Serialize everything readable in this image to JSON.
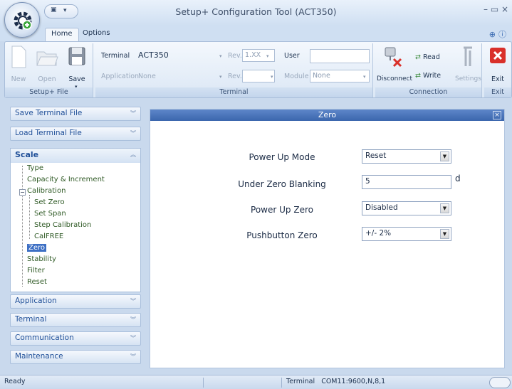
{
  "window": {
    "title": "Setup+ Configuration Tool (ACT350)",
    "controls": "– ▭ ×"
  },
  "tabs": [
    {
      "label": "Home"
    },
    {
      "label": "Options"
    }
  ],
  "ribbon": {
    "setup_file": {
      "group_label": "Setup+ File",
      "new": "New",
      "open": "Open",
      "save": "Save"
    },
    "terminal": {
      "group_label": "Terminal",
      "terminal_label": "Terminal",
      "terminal_value": "ACT350",
      "rev_label": "Rev.",
      "rev_value": "1.XX",
      "user_label": "User",
      "user_value": "",
      "application_label": "Application",
      "application_value": "None",
      "rev2_label": "Rev.",
      "rev2_value": "",
      "module_label": "Module",
      "module_value": "None"
    },
    "connection": {
      "group_label": "Connection",
      "disconnect": "Disconnect",
      "read": "Read",
      "write": "Write",
      "settings": "Settings"
    },
    "exit": {
      "group_label": "Exit",
      "exit": "Exit"
    }
  },
  "sidebar": {
    "save_terminal_file": "Save Terminal File",
    "load_terminal_file": "Load Terminal File",
    "scale": {
      "label": "Scale",
      "items": {
        "type": "Type",
        "capacity": "Capacity & Increment",
        "calibration": "Calibration",
        "set_zero": "Set Zero",
        "set_span": "Set Span",
        "step_calibration": "Step Calibration",
        "calfree": "CalFREE",
        "zero": "Zero",
        "stability": "Stability",
        "filter": "Filter",
        "reset": "Reset"
      }
    },
    "application": "Application",
    "terminal": "Terminal",
    "communication": "Communication",
    "maintenance": "Maintenance"
  },
  "panel": {
    "title": "Zero",
    "fields": {
      "power_up_mode": {
        "label": "Power Up Mode",
        "value": "Reset"
      },
      "under_zero_blanking": {
        "label": "Under Zero Blanking",
        "value": "5",
        "unit": "d"
      },
      "power_up_zero": {
        "label": "Power Up Zero",
        "value": "Disabled"
      },
      "pushbutton_zero": {
        "label": "Pushbutton Zero",
        "value": "+/- 2%"
      }
    }
  },
  "status": {
    "ready": "Ready",
    "terminal_label": "Terminal",
    "port": "COM11:9600,N,8,1"
  },
  "colors": {
    "accent": "#3b66ad",
    "exit_red": "#d9302a",
    "tree_text": "#2f5a25"
  }
}
